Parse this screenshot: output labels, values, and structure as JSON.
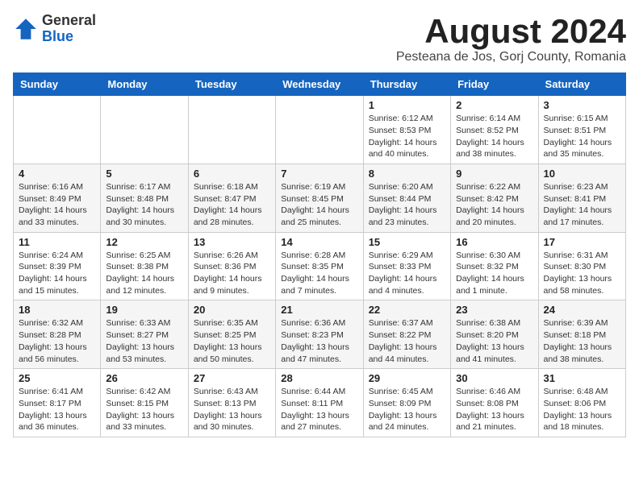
{
  "logo": {
    "general": "General",
    "blue": "Blue"
  },
  "title": {
    "month_year": "August 2024",
    "location": "Pesteana de Jos, Gorj County, Romania"
  },
  "weekdays": [
    "Sunday",
    "Monday",
    "Tuesday",
    "Wednesday",
    "Thursday",
    "Friday",
    "Saturday"
  ],
  "weeks": [
    [
      {
        "day": "",
        "detail": ""
      },
      {
        "day": "",
        "detail": ""
      },
      {
        "day": "",
        "detail": ""
      },
      {
        "day": "",
        "detail": ""
      },
      {
        "day": "1",
        "detail": "Sunrise: 6:12 AM\nSunset: 8:53 PM\nDaylight: 14 hours and 40 minutes."
      },
      {
        "day": "2",
        "detail": "Sunrise: 6:14 AM\nSunset: 8:52 PM\nDaylight: 14 hours and 38 minutes."
      },
      {
        "day": "3",
        "detail": "Sunrise: 6:15 AM\nSunset: 8:51 PM\nDaylight: 14 hours and 35 minutes."
      }
    ],
    [
      {
        "day": "4",
        "detail": "Sunrise: 6:16 AM\nSunset: 8:49 PM\nDaylight: 14 hours and 33 minutes."
      },
      {
        "day": "5",
        "detail": "Sunrise: 6:17 AM\nSunset: 8:48 PM\nDaylight: 14 hours and 30 minutes."
      },
      {
        "day": "6",
        "detail": "Sunrise: 6:18 AM\nSunset: 8:47 PM\nDaylight: 14 hours and 28 minutes."
      },
      {
        "day": "7",
        "detail": "Sunrise: 6:19 AM\nSunset: 8:45 PM\nDaylight: 14 hours and 25 minutes."
      },
      {
        "day": "8",
        "detail": "Sunrise: 6:20 AM\nSunset: 8:44 PM\nDaylight: 14 hours and 23 minutes."
      },
      {
        "day": "9",
        "detail": "Sunrise: 6:22 AM\nSunset: 8:42 PM\nDaylight: 14 hours and 20 minutes."
      },
      {
        "day": "10",
        "detail": "Sunrise: 6:23 AM\nSunset: 8:41 PM\nDaylight: 14 hours and 17 minutes."
      }
    ],
    [
      {
        "day": "11",
        "detail": "Sunrise: 6:24 AM\nSunset: 8:39 PM\nDaylight: 14 hours and 15 minutes."
      },
      {
        "day": "12",
        "detail": "Sunrise: 6:25 AM\nSunset: 8:38 PM\nDaylight: 14 hours and 12 minutes."
      },
      {
        "day": "13",
        "detail": "Sunrise: 6:26 AM\nSunset: 8:36 PM\nDaylight: 14 hours and 9 minutes."
      },
      {
        "day": "14",
        "detail": "Sunrise: 6:28 AM\nSunset: 8:35 PM\nDaylight: 14 hours and 7 minutes."
      },
      {
        "day": "15",
        "detail": "Sunrise: 6:29 AM\nSunset: 8:33 PM\nDaylight: 14 hours and 4 minutes."
      },
      {
        "day": "16",
        "detail": "Sunrise: 6:30 AM\nSunset: 8:32 PM\nDaylight: 14 hours and 1 minute."
      },
      {
        "day": "17",
        "detail": "Sunrise: 6:31 AM\nSunset: 8:30 PM\nDaylight: 13 hours and 58 minutes."
      }
    ],
    [
      {
        "day": "18",
        "detail": "Sunrise: 6:32 AM\nSunset: 8:28 PM\nDaylight: 13 hours and 56 minutes."
      },
      {
        "day": "19",
        "detail": "Sunrise: 6:33 AM\nSunset: 8:27 PM\nDaylight: 13 hours and 53 minutes."
      },
      {
        "day": "20",
        "detail": "Sunrise: 6:35 AM\nSunset: 8:25 PM\nDaylight: 13 hours and 50 minutes."
      },
      {
        "day": "21",
        "detail": "Sunrise: 6:36 AM\nSunset: 8:23 PM\nDaylight: 13 hours and 47 minutes."
      },
      {
        "day": "22",
        "detail": "Sunrise: 6:37 AM\nSunset: 8:22 PM\nDaylight: 13 hours and 44 minutes."
      },
      {
        "day": "23",
        "detail": "Sunrise: 6:38 AM\nSunset: 8:20 PM\nDaylight: 13 hours and 41 minutes."
      },
      {
        "day": "24",
        "detail": "Sunrise: 6:39 AM\nSunset: 8:18 PM\nDaylight: 13 hours and 38 minutes."
      }
    ],
    [
      {
        "day": "25",
        "detail": "Sunrise: 6:41 AM\nSunset: 8:17 PM\nDaylight: 13 hours and 36 minutes."
      },
      {
        "day": "26",
        "detail": "Sunrise: 6:42 AM\nSunset: 8:15 PM\nDaylight: 13 hours and 33 minutes."
      },
      {
        "day": "27",
        "detail": "Sunrise: 6:43 AM\nSunset: 8:13 PM\nDaylight: 13 hours and 30 minutes."
      },
      {
        "day": "28",
        "detail": "Sunrise: 6:44 AM\nSunset: 8:11 PM\nDaylight: 13 hours and 27 minutes."
      },
      {
        "day": "29",
        "detail": "Sunrise: 6:45 AM\nSunset: 8:09 PM\nDaylight: 13 hours and 24 minutes."
      },
      {
        "day": "30",
        "detail": "Sunrise: 6:46 AM\nSunset: 8:08 PM\nDaylight: 13 hours and 21 minutes."
      },
      {
        "day": "31",
        "detail": "Sunrise: 6:48 AM\nSunset: 8:06 PM\nDaylight: 13 hours and 18 minutes."
      }
    ]
  ]
}
